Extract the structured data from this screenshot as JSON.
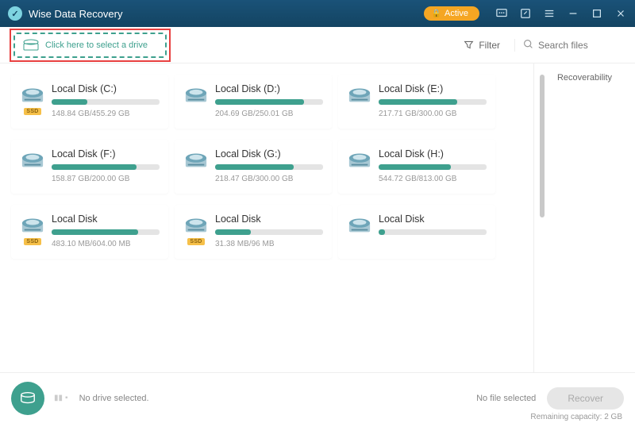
{
  "titlebar": {
    "app_name": "Wise Data Recovery",
    "active_label": "Active"
  },
  "toolbar": {
    "select_drive_label": "Click here to select a drive",
    "filter_label": "Filter",
    "search_placeholder": "Search files"
  },
  "results": {
    "header": "Recoverability"
  },
  "drives": [
    {
      "name": "Local Disk (C:)",
      "size": "148.84 GB/455.29 GB",
      "fill": 33,
      "ssd": true
    },
    {
      "name": "Local Disk (D:)",
      "size": "204.69 GB/250.01 GB",
      "fill": 82,
      "ssd": false
    },
    {
      "name": "Local Disk (E:)",
      "size": "217.71 GB/300.00 GB",
      "fill": 73,
      "ssd": false
    },
    {
      "name": "Local Disk (F:)",
      "size": "158.87 GB/200.00 GB",
      "fill": 79,
      "ssd": false
    },
    {
      "name": "Local Disk (G:)",
      "size": "218.47 GB/300.00 GB",
      "fill": 73,
      "ssd": false
    },
    {
      "name": "Local Disk (H:)",
      "size": "544.72 GB/813.00 GB",
      "fill": 67,
      "ssd": false
    },
    {
      "name": "Local Disk",
      "size": "483.10 MB/604.00 MB",
      "fill": 80,
      "ssd": true
    },
    {
      "name": "Local Disk",
      "size": "31.38 MB/96 MB",
      "fill": 33,
      "ssd": true
    },
    {
      "name": "Local Disk",
      "size": "",
      "fill": 6,
      "ssd": false
    }
  ],
  "footer": {
    "no_drive": "No drive selected.",
    "no_file": "No file selected",
    "recover_label": "Recover",
    "remaining": "Remaining capacity: 2 GB"
  },
  "ssd_badge_text": "SSD"
}
